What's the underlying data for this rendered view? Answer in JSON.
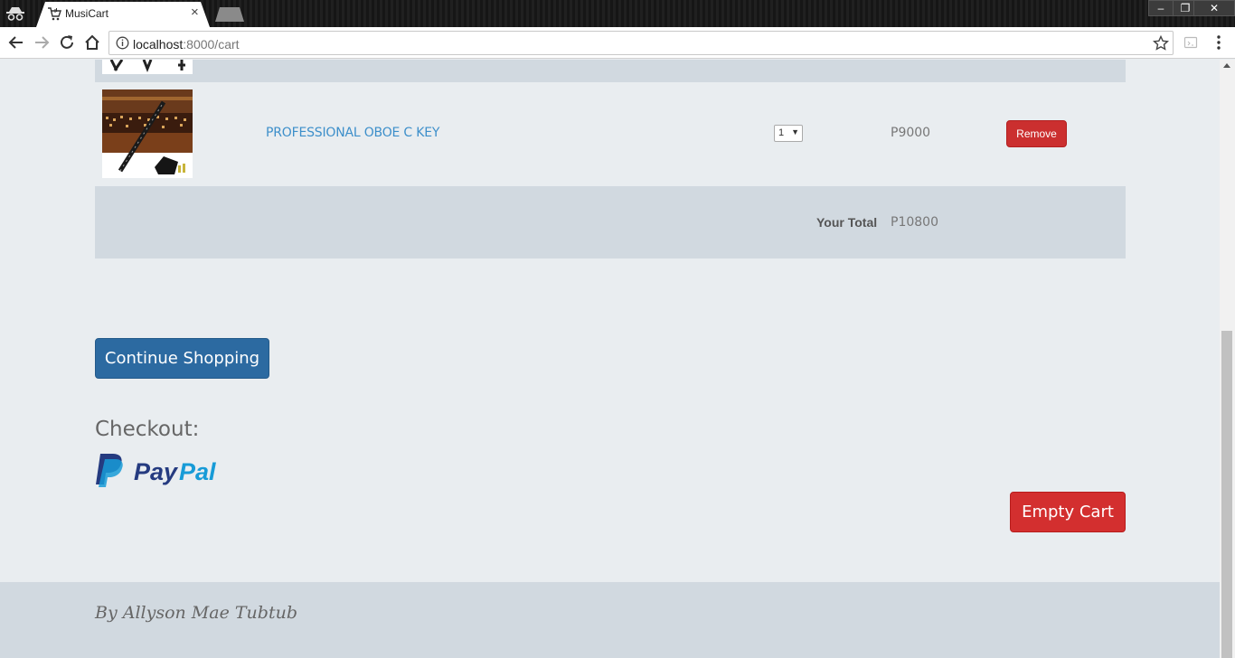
{
  "browser": {
    "tab_title": "MusiCart",
    "tab_close": "×",
    "url_host": "localhost",
    "url_path": ":8000/cart",
    "window_buttons": {
      "minimize": "–",
      "restore": "❐",
      "close": "✕"
    }
  },
  "cart": {
    "items": [
      {
        "name": "PROFESSIONAL OBOE C KEY",
        "quantity": "1",
        "price": "P9000",
        "remove_label": "Remove"
      }
    ],
    "total_label": "Your Total",
    "total_value": "P10800"
  },
  "actions": {
    "continue_label": "Continue Shopping",
    "checkout_label": "Checkout:",
    "paypal_label": "PayPal",
    "empty_label": "Empty Cart"
  },
  "footer": {
    "text": "By Allyson Mae Tubtub"
  },
  "colors": {
    "link": "#3d8fca",
    "primary_button": "#2c6aa1",
    "danger_button": "#d32f2f",
    "row_shade": "#d1d9e0",
    "page_bg": "#e9edf0"
  }
}
